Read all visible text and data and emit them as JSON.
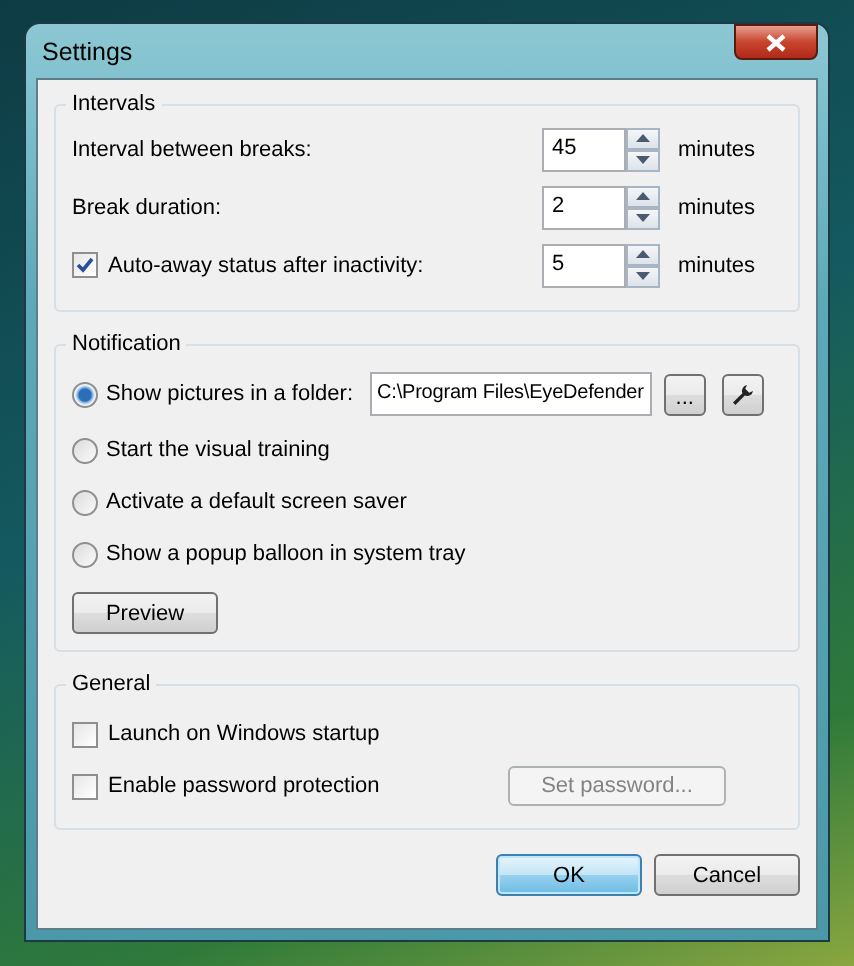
{
  "window": {
    "title": "Settings"
  },
  "intervals": {
    "title": "Intervals",
    "rows": [
      {
        "kind": "plain",
        "label": "Interval between breaks:",
        "value": "45",
        "unit": "minutes"
      },
      {
        "kind": "plain",
        "label": "Break duration:",
        "value": "2",
        "unit": "minutes"
      },
      {
        "kind": "checkbox",
        "label": "Auto-away status after inactivity:",
        "checked": true,
        "value": "5",
        "unit": "minutes"
      }
    ]
  },
  "notification": {
    "title": "Notification",
    "options": [
      {
        "kind": "folder",
        "label": "Show pictures in a folder:",
        "selected": true,
        "folder": "C:\\Program Files\\EyeDefender",
        "browse": "..."
      },
      {
        "kind": "plain",
        "label": "Start the visual training",
        "selected": false
      },
      {
        "kind": "plain",
        "label": "Activate a default screen saver",
        "selected": false
      },
      {
        "kind": "plain",
        "label": "Show a popup balloon in system tray",
        "selected": false
      }
    ],
    "preview": "Preview"
  },
  "general": {
    "title": "General",
    "options": [
      {
        "label": "Launch on Windows startup",
        "checked": false
      },
      {
        "label": "Enable password protection",
        "checked": false
      }
    ],
    "password_button": {
      "label": "Set password...",
      "disabled": true
    }
  },
  "buttons": [
    {
      "label": "OK",
      "default": true
    },
    {
      "label": "Cancel",
      "default": false
    }
  ]
}
